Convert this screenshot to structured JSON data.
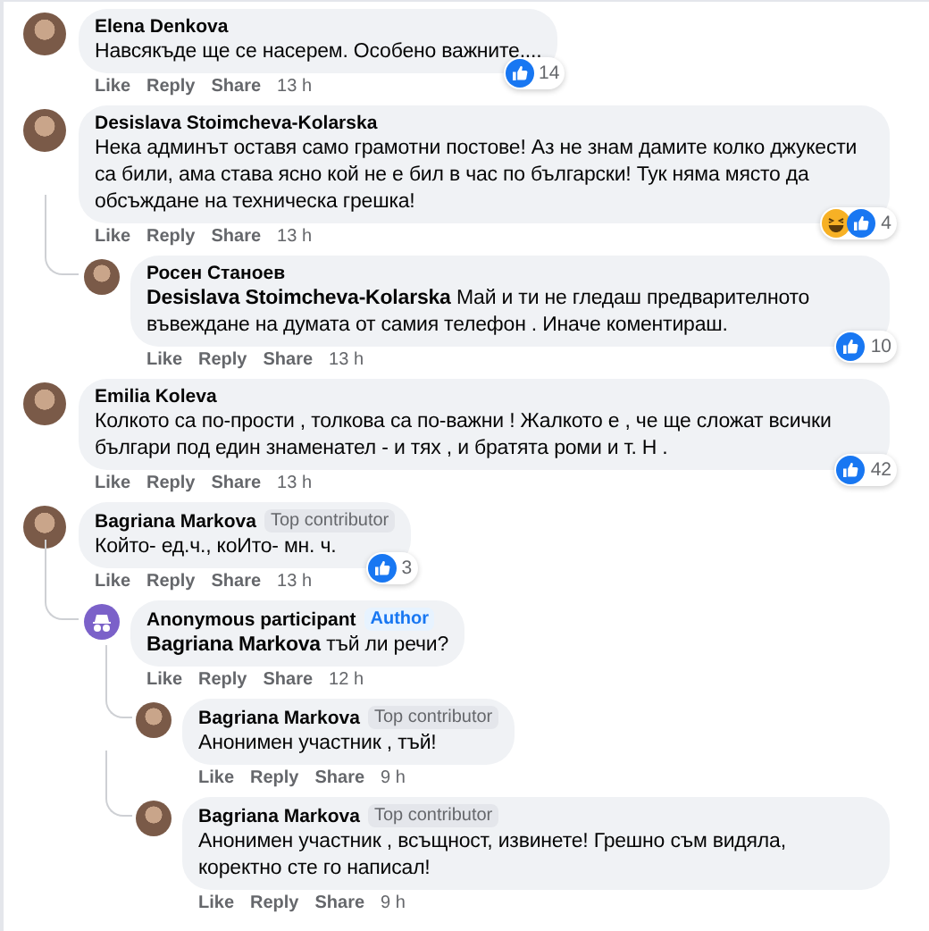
{
  "comments": [
    {
      "avatar": {
        "kind": "photo"
      },
      "author": "Elena Denkova",
      "text": "Навсякъде ще се насерем. Особено важните....",
      "actions": [
        "Like",
        "Reply",
        "Share"
      ],
      "time": "13 h",
      "reactions": [
        {
          "kind": "like"
        }
      ],
      "reaction_count": "14"
    },
    {
      "avatar": {
        "kind": "photo"
      },
      "author": "Desislava Stoimcheva-Kolarska",
      "text": "Нека админът оставя само грамотни постове! Аз не знам дамите колко джукести са били, ама става ясно кой не е бил в час по български! Тук няма място да обсъждане на техническа грешка!",
      "actions": [
        "Like",
        "Reply",
        "Share"
      ],
      "time": "13 h",
      "reactions": [
        {
          "kind": "haha"
        },
        {
          "kind": "like"
        }
      ],
      "reaction_count": "4",
      "children": [
        {
          "avatar": {
            "kind": "photo"
          },
          "author": "Росен Станоев",
          "text": "**Desislava Stoimcheva-Kolarska** Май и ти не гледаш предварителното въвеждане на думата от самия телефон . Иначе коментираш.",
          "actions": [
            "Like",
            "Reply",
            "Share"
          ],
          "time": "13 h",
          "reactions": [
            {
              "kind": "like"
            }
          ],
          "reaction_count": "10"
        }
      ]
    },
    {
      "avatar": {
        "kind": "photo"
      },
      "author": "Emilia Koleva",
      "text": "Колкото са по-прости , толкова са по-важни ! Жалкото е , че ще сложат всички българи под един знаменател - и тях , и братята роми и т. Н .",
      "actions": [
        "Like",
        "Reply",
        "Share"
      ],
      "time": "13 h",
      "reactions": [
        {
          "kind": "like"
        }
      ],
      "reaction_count": "42"
    },
    {
      "avatar": {
        "kind": "photo"
      },
      "author": "Bagriana Markova",
      "badge": {
        "kind": "contributor",
        "text": "Top contributor"
      },
      "text": "Който- ед.ч., коИто- мн. ч.",
      "actions": [
        "Like",
        "Reply",
        "Share"
      ],
      "time": "13 h",
      "reactions": [
        {
          "kind": "like"
        }
      ],
      "reaction_count": "3",
      "children": [
        {
          "avatar": {
            "kind": "anonymous"
          },
          "author": "Anonymous participant",
          "badge": {
            "kind": "author",
            "text": "Author"
          },
          "text": "**Bagriana Markova** тъй ли речи?",
          "actions": [
            "Like",
            "Reply",
            "Share"
          ],
          "time": "12 h",
          "children": [
            {
              "avatar": {
                "kind": "photo"
              },
              "author": "Bagriana Markova",
              "badge": {
                "kind": "contributor",
                "text": "Top contributor"
              },
              "text": "Анонимен участник , тъй!",
              "actions": [
                "Like",
                "Reply",
                "Share"
              ],
              "time": "9 h"
            },
            {
              "avatar": {
                "kind": "photo"
              },
              "author": "Bagriana Markova",
              "badge": {
                "kind": "contributor",
                "text": "Top contributor"
              },
              "text": "Анонимен участник , всъщност, извинете! Грешно съм видяла, коректно сте го написал!",
              "actions": [
                "Like",
                "Reply",
                "Share"
              ],
              "time": "9 h"
            }
          ]
        }
      ]
    }
  ]
}
